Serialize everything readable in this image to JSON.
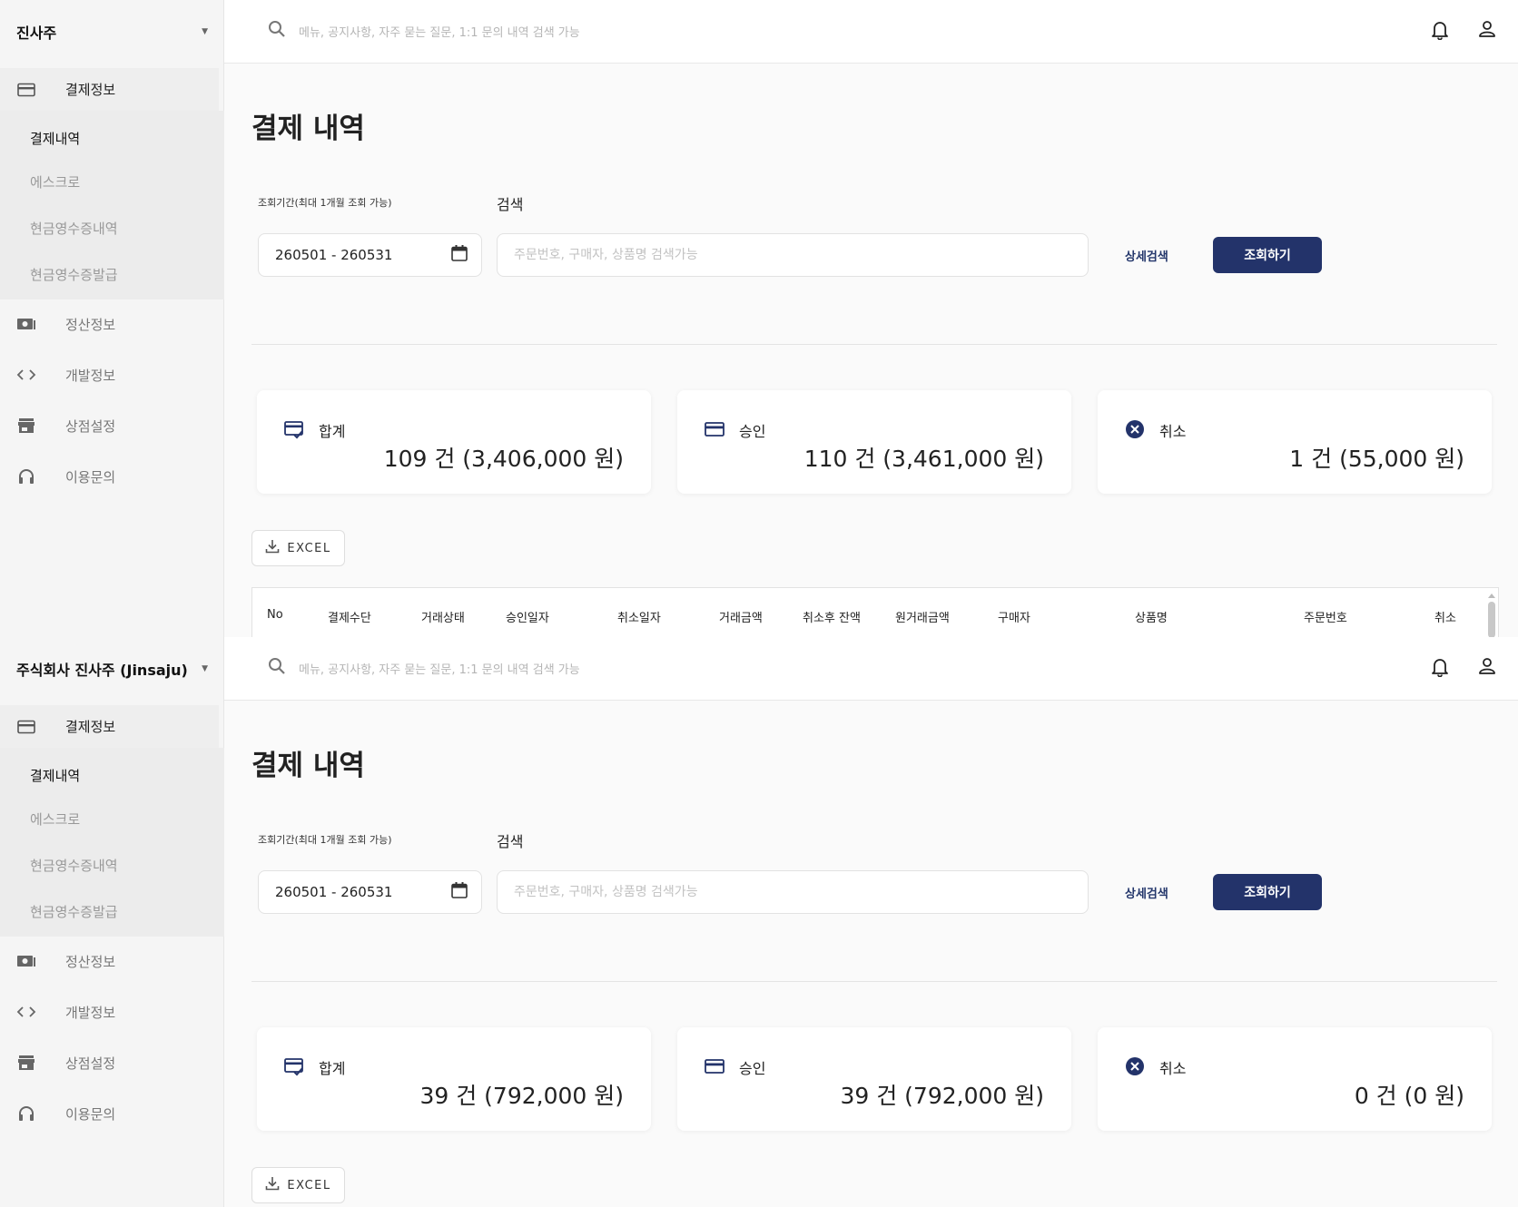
{
  "screens": [
    {
      "company": "진사주",
      "search_placeholder": "메뉴, 공지사항, 자주 묻는 질문, 1:1 문의 내역 검색 가능",
      "nav": {
        "payment_info": "결제정보",
        "sub": [
          "결제내역",
          "에스크로",
          "현금영수증내역",
          "현금영수증발급"
        ],
        "settlement_info": "정산정보",
        "dev_info": "개발정보",
        "store_settings": "상점설정",
        "inquiry": "이용문의"
      },
      "page_title": "결제 내역",
      "period_label": "조회기간(최대 1개월 조회 가능)",
      "search_label": "검색",
      "date_range": "260501 - 260531",
      "search_field_placeholder": "주문번호, 구매자, 상품명 검색가능",
      "detail_search": "상세검색",
      "query_button": "조회하기",
      "cards": [
        {
          "title": "합계",
          "value": "109 건 (3,406,000 원)"
        },
        {
          "title": "승인",
          "value": "110 건 (3,461,000 원)"
        },
        {
          "title": "취소",
          "value": "1 건 (55,000 원)"
        }
      ],
      "excel": "EXCEL",
      "columns": [
        "No",
        "결제수단",
        "거래상태",
        "승인일자",
        "취소일자",
        "거래금액",
        "취소후 잔액",
        "원거래금액",
        "구매자",
        "상품명",
        "주문번호",
        "취소"
      ]
    },
    {
      "company": "주식회사 진사주 (Jinsaju)",
      "search_placeholder": "메뉴, 공지사항, 자주 묻는 질문, 1:1 문의 내역 검색 가능",
      "nav": {
        "payment_info": "결제정보",
        "sub": [
          "결제내역",
          "에스크로",
          "현금영수증내역",
          "현금영수증발급"
        ],
        "settlement_info": "정산정보",
        "dev_info": "개발정보",
        "store_settings": "상점설정",
        "inquiry": "이용문의"
      },
      "page_title": "결제 내역",
      "period_label": "조회기간(최대 1개월 조회 가능)",
      "search_label": "검색",
      "date_range": "260501 - 260531",
      "search_field_placeholder": "주문번호, 구매자, 상품명 검색가능",
      "detail_search": "상세검색",
      "query_button": "조회하기",
      "cards": [
        {
          "title": "합계",
          "value": "39 건 (792,000 원)"
        },
        {
          "title": "승인",
          "value": "39 건 (792,000 원)"
        },
        {
          "title": "취소",
          "value": "0 건 (0 원)"
        }
      ],
      "excel": "EXCEL"
    }
  ],
  "colors": {
    "primary": "#23336a",
    "sidebar_bg": "#f5f5f5",
    "cancel_icon": "#23336a"
  },
  "icons": [
    "chevron-down-icon",
    "credit-card-icon",
    "money-icon",
    "code-icon",
    "store-icon",
    "headset-icon",
    "search-icon",
    "bell-icon",
    "user-icon",
    "calendar-icon",
    "card-check-icon",
    "cancel-circle-icon",
    "download-icon"
  ]
}
